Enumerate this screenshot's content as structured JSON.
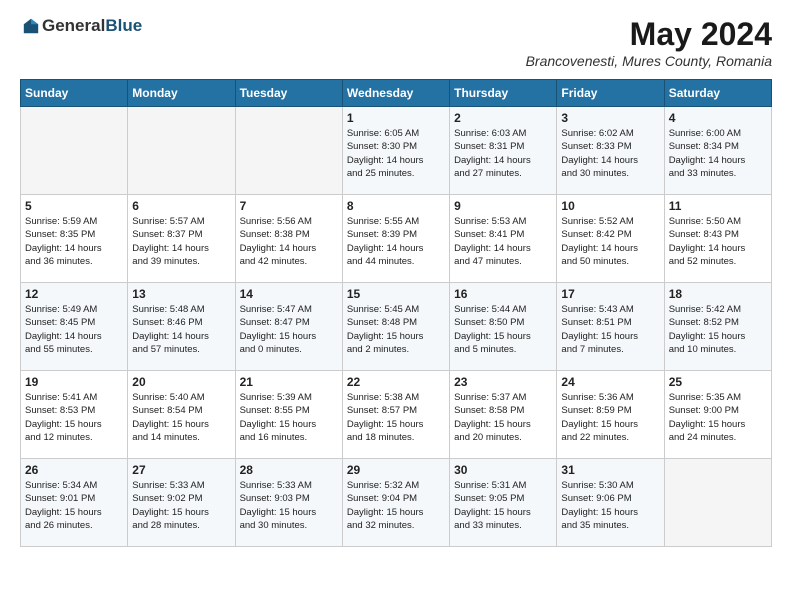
{
  "header": {
    "logo_general": "General",
    "logo_blue": "Blue",
    "month_year": "May 2024",
    "location": "Brancovenesti, Mures County, Romania"
  },
  "weekdays": [
    "Sunday",
    "Monday",
    "Tuesday",
    "Wednesday",
    "Thursday",
    "Friday",
    "Saturday"
  ],
  "weeks": [
    [
      {
        "day": "",
        "info": ""
      },
      {
        "day": "",
        "info": ""
      },
      {
        "day": "",
        "info": ""
      },
      {
        "day": "1",
        "info": "Sunrise: 6:05 AM\nSunset: 8:30 PM\nDaylight: 14 hours\nand 25 minutes."
      },
      {
        "day": "2",
        "info": "Sunrise: 6:03 AM\nSunset: 8:31 PM\nDaylight: 14 hours\nand 27 minutes."
      },
      {
        "day": "3",
        "info": "Sunrise: 6:02 AM\nSunset: 8:33 PM\nDaylight: 14 hours\nand 30 minutes."
      },
      {
        "day": "4",
        "info": "Sunrise: 6:00 AM\nSunset: 8:34 PM\nDaylight: 14 hours\nand 33 minutes."
      }
    ],
    [
      {
        "day": "5",
        "info": "Sunrise: 5:59 AM\nSunset: 8:35 PM\nDaylight: 14 hours\nand 36 minutes."
      },
      {
        "day": "6",
        "info": "Sunrise: 5:57 AM\nSunset: 8:37 PM\nDaylight: 14 hours\nand 39 minutes."
      },
      {
        "day": "7",
        "info": "Sunrise: 5:56 AM\nSunset: 8:38 PM\nDaylight: 14 hours\nand 42 minutes."
      },
      {
        "day": "8",
        "info": "Sunrise: 5:55 AM\nSunset: 8:39 PM\nDaylight: 14 hours\nand 44 minutes."
      },
      {
        "day": "9",
        "info": "Sunrise: 5:53 AM\nSunset: 8:41 PM\nDaylight: 14 hours\nand 47 minutes."
      },
      {
        "day": "10",
        "info": "Sunrise: 5:52 AM\nSunset: 8:42 PM\nDaylight: 14 hours\nand 50 minutes."
      },
      {
        "day": "11",
        "info": "Sunrise: 5:50 AM\nSunset: 8:43 PM\nDaylight: 14 hours\nand 52 minutes."
      }
    ],
    [
      {
        "day": "12",
        "info": "Sunrise: 5:49 AM\nSunset: 8:45 PM\nDaylight: 14 hours\nand 55 minutes."
      },
      {
        "day": "13",
        "info": "Sunrise: 5:48 AM\nSunset: 8:46 PM\nDaylight: 14 hours\nand 57 minutes."
      },
      {
        "day": "14",
        "info": "Sunrise: 5:47 AM\nSunset: 8:47 PM\nDaylight: 15 hours\nand 0 minutes."
      },
      {
        "day": "15",
        "info": "Sunrise: 5:45 AM\nSunset: 8:48 PM\nDaylight: 15 hours\nand 2 minutes."
      },
      {
        "day": "16",
        "info": "Sunrise: 5:44 AM\nSunset: 8:50 PM\nDaylight: 15 hours\nand 5 minutes."
      },
      {
        "day": "17",
        "info": "Sunrise: 5:43 AM\nSunset: 8:51 PM\nDaylight: 15 hours\nand 7 minutes."
      },
      {
        "day": "18",
        "info": "Sunrise: 5:42 AM\nSunset: 8:52 PM\nDaylight: 15 hours\nand 10 minutes."
      }
    ],
    [
      {
        "day": "19",
        "info": "Sunrise: 5:41 AM\nSunset: 8:53 PM\nDaylight: 15 hours\nand 12 minutes."
      },
      {
        "day": "20",
        "info": "Sunrise: 5:40 AM\nSunset: 8:54 PM\nDaylight: 15 hours\nand 14 minutes."
      },
      {
        "day": "21",
        "info": "Sunrise: 5:39 AM\nSunset: 8:55 PM\nDaylight: 15 hours\nand 16 minutes."
      },
      {
        "day": "22",
        "info": "Sunrise: 5:38 AM\nSunset: 8:57 PM\nDaylight: 15 hours\nand 18 minutes."
      },
      {
        "day": "23",
        "info": "Sunrise: 5:37 AM\nSunset: 8:58 PM\nDaylight: 15 hours\nand 20 minutes."
      },
      {
        "day": "24",
        "info": "Sunrise: 5:36 AM\nSunset: 8:59 PM\nDaylight: 15 hours\nand 22 minutes."
      },
      {
        "day": "25",
        "info": "Sunrise: 5:35 AM\nSunset: 9:00 PM\nDaylight: 15 hours\nand 24 minutes."
      }
    ],
    [
      {
        "day": "26",
        "info": "Sunrise: 5:34 AM\nSunset: 9:01 PM\nDaylight: 15 hours\nand 26 minutes."
      },
      {
        "day": "27",
        "info": "Sunrise: 5:33 AM\nSunset: 9:02 PM\nDaylight: 15 hours\nand 28 minutes."
      },
      {
        "day": "28",
        "info": "Sunrise: 5:33 AM\nSunset: 9:03 PM\nDaylight: 15 hours\nand 30 minutes."
      },
      {
        "day": "29",
        "info": "Sunrise: 5:32 AM\nSunset: 9:04 PM\nDaylight: 15 hours\nand 32 minutes."
      },
      {
        "day": "30",
        "info": "Sunrise: 5:31 AM\nSunset: 9:05 PM\nDaylight: 15 hours\nand 33 minutes."
      },
      {
        "day": "31",
        "info": "Sunrise: 5:30 AM\nSunset: 9:06 PM\nDaylight: 15 hours\nand 35 minutes."
      },
      {
        "day": "",
        "info": ""
      }
    ]
  ]
}
